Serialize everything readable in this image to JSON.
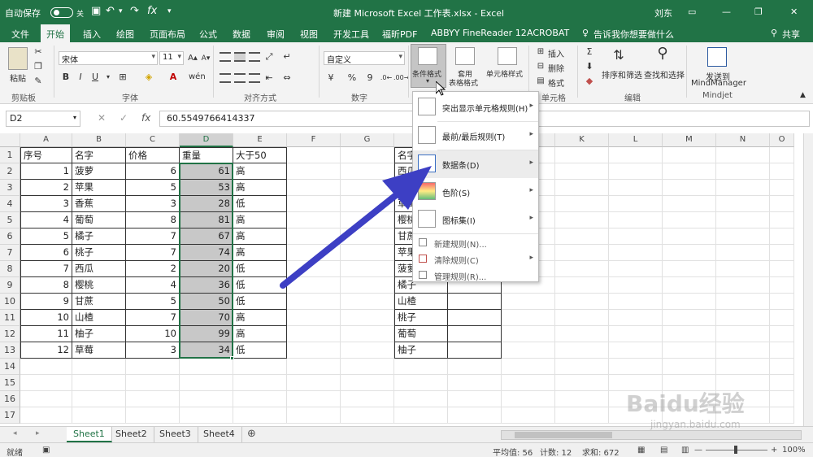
{
  "titlebar": {
    "autosave_label": "自动保存",
    "autosave_state": "关",
    "doc_title": "新建 Microsoft Excel 工作表.xlsx  -  Excel",
    "user": "刘东",
    "window_buttons": [
      "—",
      "❐",
      "✕"
    ]
  },
  "tabs": [
    "文件",
    "开始",
    "插入",
    "绘图",
    "页面布局",
    "公式",
    "数据",
    "审阅",
    "视图",
    "开发工具",
    "福昕PDF",
    "ABBYY FineReader 12",
    "ACROBAT",
    "告诉我你想要做什么",
    "共享"
  ],
  "active_tab": "开始",
  "ribbon": {
    "clipboard": {
      "paste": "粘贴",
      "group": "剪贴板"
    },
    "font": {
      "name": "宋体",
      "size": "11",
      "group": "字体",
      "bold": "B",
      "italic": "I",
      "underline": "U"
    },
    "alignment": {
      "group": "对齐方式"
    },
    "number": {
      "format": "自定义",
      "group": "数字",
      "percent": "%",
      "comma": "9"
    },
    "styles": {
      "conditional": "条件格式",
      "table_1": "套用",
      "table_2": "表格格式",
      "cell_styles": "单元格样式"
    },
    "cells": {
      "insert": "插入",
      "delete": "删除",
      "format": "格式",
      "group": "单元格"
    },
    "editing": {
      "sort": "排序和筛选",
      "find": "查找和选择",
      "group": "编辑"
    },
    "mindjet": {
      "send_1": "发送到",
      "send_2": "MindManager",
      "group": "Mindjet"
    }
  },
  "formula_bar": {
    "cell_ref": "D2",
    "fx": "fx",
    "value": "60.5549766414337"
  },
  "columns": [
    "A",
    "B",
    "C",
    "D",
    "E",
    "F",
    "G",
    "H",
    "I",
    "J",
    "K",
    "L",
    "M",
    "N",
    "O"
  ],
  "rows": [
    "1",
    "2",
    "3",
    "4",
    "5",
    "6",
    "7",
    "8",
    "9",
    "10",
    "11",
    "12",
    "13",
    "14",
    "15",
    "16",
    "17"
  ],
  "table1": {
    "headers": [
      "序号",
      "名字",
      "价格",
      "重量",
      "大于50"
    ],
    "rows": [
      [
        "1",
        "菠萝",
        "6",
        "61",
        "高"
      ],
      [
        "2",
        "苹果",
        "5",
        "53",
        "高"
      ],
      [
        "3",
        "香蕉",
        "3",
        "28",
        "低"
      ],
      [
        "4",
        "葡萄",
        "8",
        "81",
        "高"
      ],
      [
        "5",
        "橘子",
        "7",
        "67",
        "高"
      ],
      [
        "6",
        "桃子",
        "7",
        "74",
        "高"
      ],
      [
        "7",
        "西瓜",
        "2",
        "20",
        "低"
      ],
      [
        "8",
        "樱桃",
        "4",
        "36",
        "低"
      ],
      [
        "9",
        "甘蔗",
        "5",
        "50",
        "低"
      ],
      [
        "10",
        "山楂",
        "7",
        "70",
        "高"
      ],
      [
        "11",
        "柚子",
        "10",
        "99",
        "高"
      ],
      [
        "12",
        "草莓",
        "3",
        "34",
        "低"
      ]
    ]
  },
  "table2": {
    "header": "名字",
    "names": [
      "西瓜",
      "草莓",
      "樱桃",
      "甘蔗",
      "苹果",
      "菠萝",
      "橘子",
      "山楂",
      "桃子",
      "葡萄",
      "柚子"
    ],
    "partial": [
      "西瓜",
      "",
      "草莓",
      "樱桃",
      "甘蔗",
      "苹果",
      "菠萝"
    ]
  },
  "cf_menu": {
    "items": [
      "突出显示单元格规则(H)",
      "最前/最后规则(T)",
      "数据条(D)",
      "色阶(S)",
      "图标集(I)"
    ],
    "small_items": [
      "新建规则(N)...",
      "清除规则(C)",
      "管理规则(R)..."
    ]
  },
  "sheets": [
    "Sheet1",
    "Sheet2",
    "Sheet3",
    "Sheet4"
  ],
  "active_sheet": "Sheet1",
  "status": {
    "mode": "就绪",
    "average": "平均值: 56",
    "count": "计数: 12",
    "sum": "求和: 672",
    "zoom": "100%"
  },
  "watermark": {
    "brand": "Baidu经验",
    "url": "jingyan.baidu.com"
  },
  "colors": {
    "excel_green": "#217346",
    "arrow": "#3d3fc4",
    "selection_grey": "#c8c8c8"
  }
}
